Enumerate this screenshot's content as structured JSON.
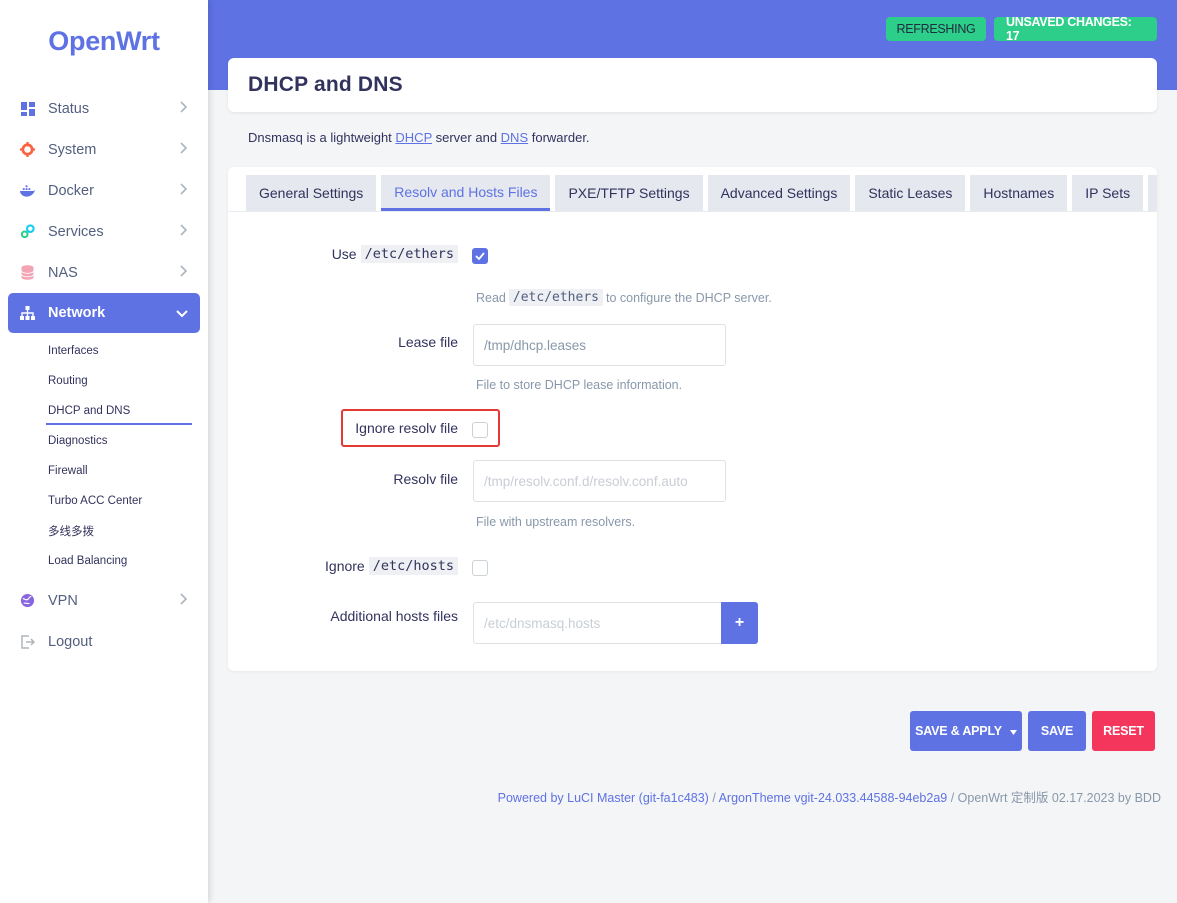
{
  "brand": "OpenWrt",
  "badges": {
    "refreshing": "REFRESHING",
    "unsaved": "UNSAVED CHANGES: 17"
  },
  "sidebar": {
    "items": [
      {
        "label": "Status",
        "icon": "dashboard-icon"
      },
      {
        "label": "System",
        "icon": "gear-icon"
      },
      {
        "label": "Docker",
        "icon": "docker-icon"
      },
      {
        "label": "Services",
        "icon": "services-icon"
      },
      {
        "label": "NAS",
        "icon": "database-icon"
      },
      {
        "label": "Network",
        "icon": "network-icon"
      },
      {
        "label": "VPN",
        "icon": "vpn-icon"
      },
      {
        "label": "Logout",
        "icon": "logout-icon"
      }
    ],
    "network_sub": [
      "Interfaces",
      "Routing",
      "DHCP and DNS",
      "Diagnostics",
      "Firewall",
      "Turbo ACC Center",
      "多线多拨",
      "Load Balancing"
    ]
  },
  "page": {
    "title": "DHCP and DNS",
    "desc_pre": "Dnsmasq is a lightweight ",
    "desc_link1": "DHCP",
    "desc_mid": " server and ",
    "desc_link2": "DNS",
    "desc_post": " forwarder."
  },
  "tabs": [
    "General Settings",
    "Resolv and Hosts Files",
    "PXE/TFTP Settings",
    "Advanced Settings",
    "Static Leases",
    "Hostnames",
    "IP Sets",
    "C"
  ],
  "form": {
    "use_ethers": {
      "pre": "Use",
      "code": "/etc/ethers",
      "checked": true,
      "help_pre": "Read",
      "help_code": "/etc/ethers",
      "help_post": "to configure the DHCP server."
    },
    "lease_file": {
      "label": "Lease file",
      "placeholder": "/tmp/dhcp.leases",
      "help": "File to store DHCP lease information."
    },
    "ignore_resolv": {
      "label": "Ignore resolv file",
      "checked": false
    },
    "resolv_file": {
      "label": "Resolv file",
      "placeholder": "/tmp/resolv.conf.d/resolv.conf.auto",
      "help": "File with upstream resolvers."
    },
    "ignore_hosts": {
      "pre": "Ignore",
      "code": "/etc/hosts",
      "checked": false
    },
    "additional_hosts": {
      "label": "Additional hosts files",
      "placeholder": "/etc/dnsmasq.hosts",
      "add_symbol": "+"
    }
  },
  "actions": {
    "save_apply": "SAVE & APPLY",
    "save": "SAVE",
    "reset": "RESET"
  },
  "footer": {
    "luci": "Powered by LuCI Master (git-fa1c483)",
    "sep1": " / ",
    "theme": "ArgonTheme vgit-24.033.44588-94eb2a9",
    "rest": " / OpenWrt 定制版 02.17.2023 by BDD"
  },
  "colors": {
    "primary": "#5e72e4",
    "success": "#2dce89",
    "danger": "#f5365c",
    "highlight": "#e53935"
  }
}
